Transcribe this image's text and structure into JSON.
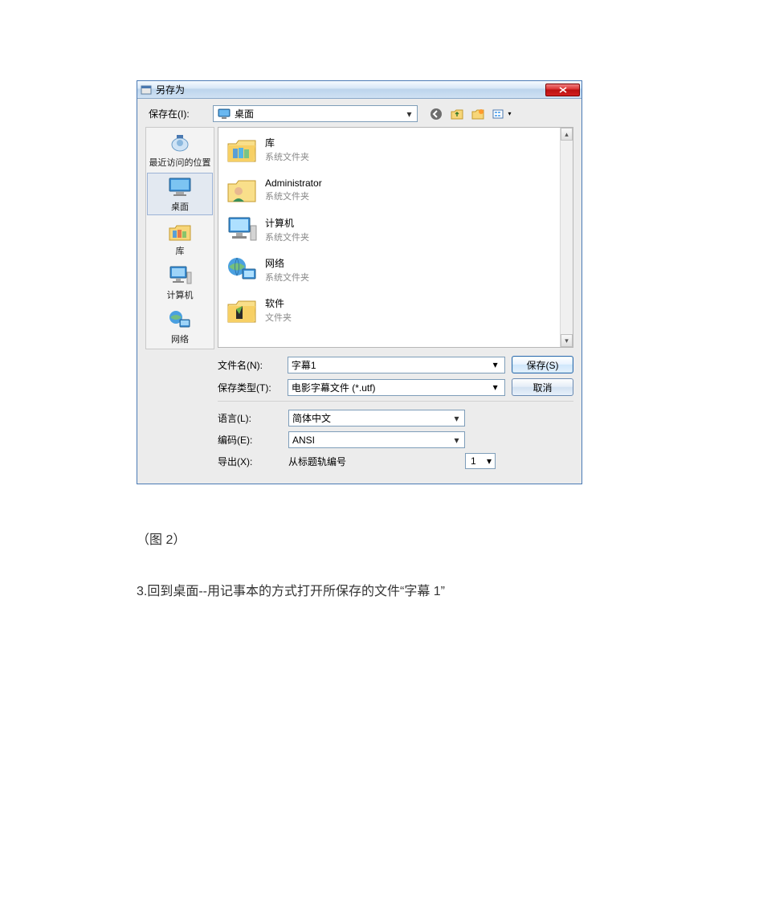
{
  "dialog": {
    "title": "另存为",
    "save_in_label": "保存在(I):",
    "location_value": "桌面",
    "toolbar_icons": {
      "back": "back-icon",
      "up": "up-folder-icon",
      "new_folder": "new-folder-icon",
      "view": "view-menu-icon"
    },
    "places": [
      {
        "label": "最近访问的位置",
        "icon": "recent-places"
      },
      {
        "label": "桌面",
        "icon": "desktop",
        "selected": true
      },
      {
        "label": "库",
        "icon": "libraries"
      },
      {
        "label": "计算机",
        "icon": "computer"
      },
      {
        "label": "网络",
        "icon": "network"
      }
    ],
    "files": [
      {
        "name": "库",
        "subtitle": "系统文件夹",
        "icon": "libraries-folder"
      },
      {
        "name": "Administrator",
        "subtitle": "系统文件夹",
        "icon": "user-folder"
      },
      {
        "name": "计算机",
        "subtitle": "系统文件夹",
        "icon": "computer-large"
      },
      {
        "name": "网络",
        "subtitle": "系统文件夹",
        "icon": "network-large"
      },
      {
        "name": "软件",
        "subtitle": "文件夹",
        "icon": "folder"
      }
    ],
    "filename_label": "文件名(N):",
    "filename_value": "字幕1",
    "filetype_label": "保存类型(T):",
    "filetype_value": "电影字幕文件 (*.utf)",
    "save_button": "保存(S)",
    "cancel_button": "取消",
    "language_label": "语言(L):",
    "language_value": "简体中文",
    "encoding_label": "编码(E):",
    "encoding_value": "ANSI",
    "export_label": "导出(X):",
    "export_text": "从标题轨编号",
    "export_number": "1"
  },
  "caption": "（图 2）",
  "instruction": "3.回到桌面--用记事本的方式打开所保存的文件“字幕 1”"
}
